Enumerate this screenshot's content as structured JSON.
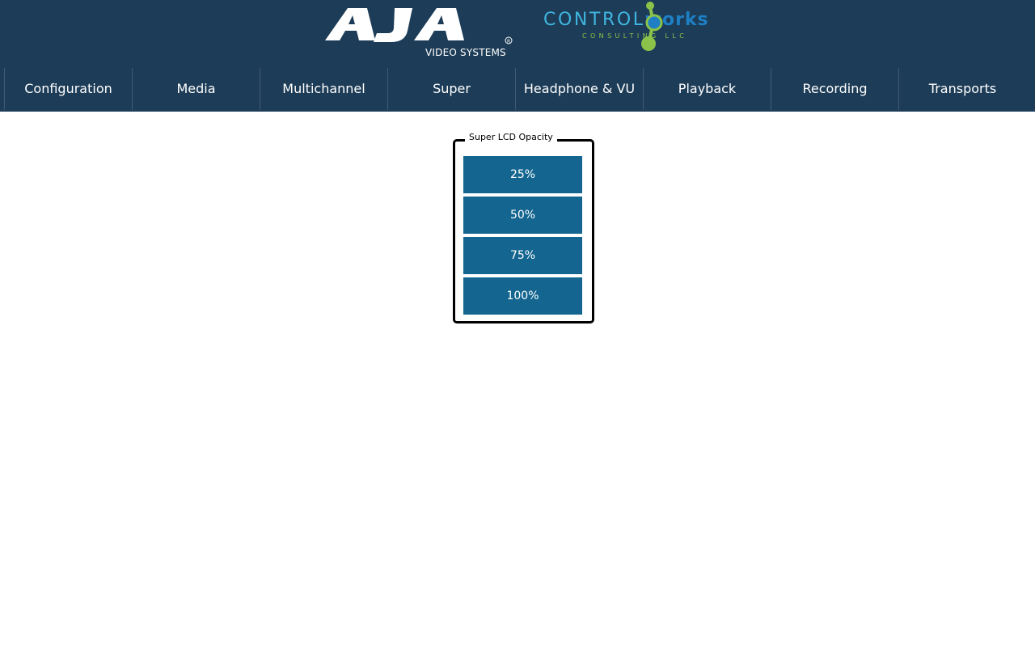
{
  "header": {
    "aja_logo": {
      "name": "AJA",
      "subtitle": "VIDEO SYSTEMS"
    },
    "cw_logo": {
      "name_part1": "CONTROL",
      "name_part2": "works",
      "subtitle": "CONSULTING  LLC"
    }
  },
  "nav": {
    "items": [
      {
        "label": "Configuration"
      },
      {
        "label": "Media"
      },
      {
        "label": "Multichannel"
      },
      {
        "label": "Super"
      },
      {
        "label": "Headphone & VU"
      },
      {
        "label": "Playback"
      },
      {
        "label": "Recording"
      },
      {
        "label": "Transports"
      }
    ]
  },
  "opacity_group": {
    "legend": "Super LCD Opacity",
    "options": [
      "25%",
      "50%",
      "75%",
      "100%"
    ]
  },
  "colors": {
    "header_bg": "#1d3c57",
    "button_bg": "#146690",
    "cw_blue": "#3fb6e0",
    "cw_green": "#8bc34a"
  }
}
